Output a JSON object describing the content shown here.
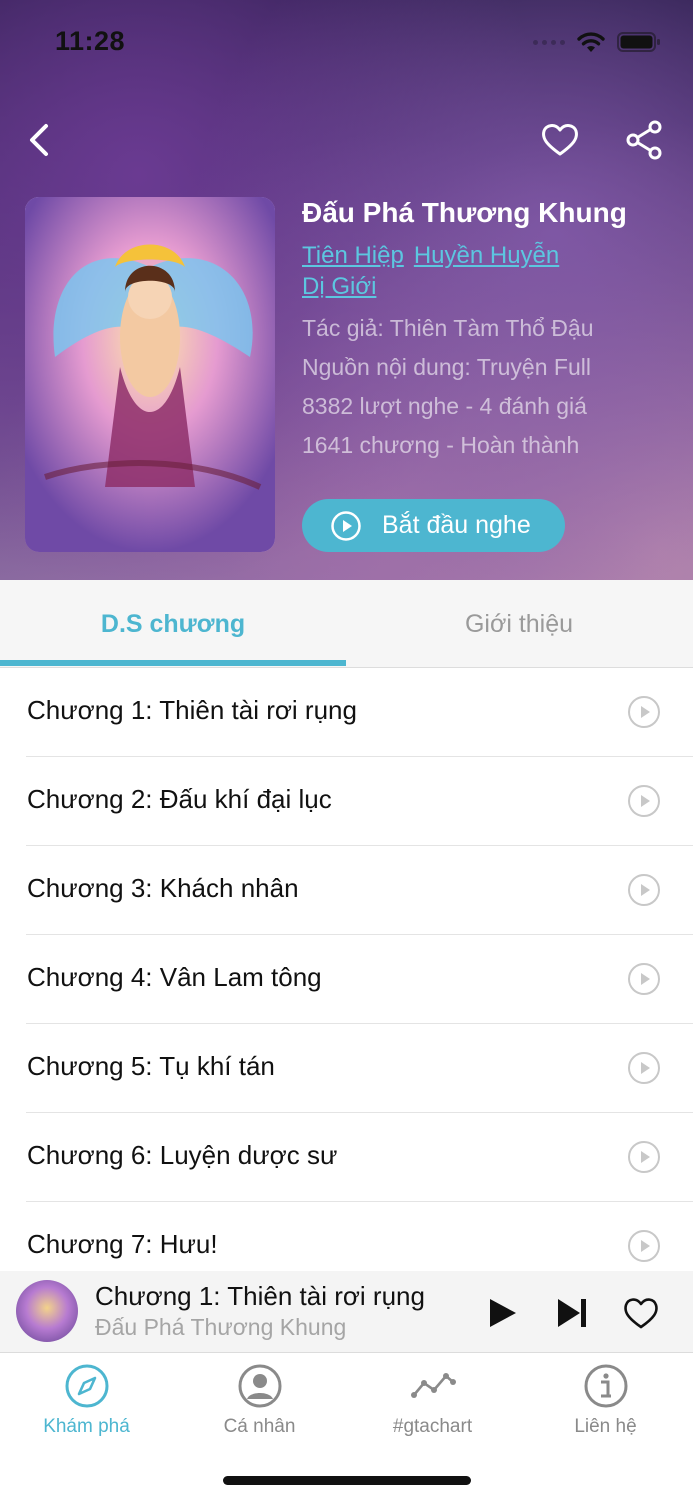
{
  "status_bar": {
    "time": "11:28"
  },
  "book": {
    "title": "Đấu Phá Thương Khung",
    "genres": [
      "Tiên Hiệp",
      "Huyền Huyễn",
      "Dị Giới"
    ],
    "author_line": "Tác giả: Thiên Tàm Thổ Đậu",
    "source_line": "Nguồn nội dung: Truyện Full",
    "stats_line": "8382 lượt nghe - 4 đánh giá",
    "chapters_line": "1641 chương - Hoàn thành",
    "start_button_label": "Bắt đầu nghe"
  },
  "tabs": {
    "chapters": "D.S chương",
    "intro": "Giới thiệu"
  },
  "chapters": [
    "Chương 1: Thiên tài rơi rụng",
    "Chương 2: Đấu khí đại lục",
    "Chương 3: Khách nhân",
    "Chương 4: Vân Lam tông",
    "Chương 5: Tụ khí tán",
    "Chương 6: Luyện dược sư",
    "Chương 7: Hưu!"
  ],
  "mini_player": {
    "title": "Chương 1: Thiên tài rơi rụng",
    "subtitle": "Đấu Phá Thương Khung"
  },
  "tabbar": {
    "explore": "Khám phá",
    "personal": "Cá nhân",
    "chart": "#gtachart",
    "contact": "Liên hệ"
  },
  "colors": {
    "accent": "#4db6d0",
    "link": "#5cc7e0"
  },
  "icons": [
    "back-icon",
    "heart-icon",
    "share-icon",
    "play-circle-icon",
    "play-icon",
    "skip-next-icon",
    "compass-icon",
    "user-icon",
    "chart-icon",
    "info-icon"
  ]
}
